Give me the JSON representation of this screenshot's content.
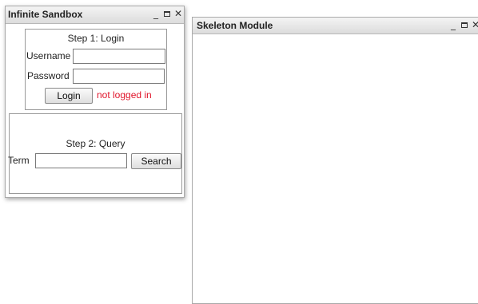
{
  "colors": {
    "status_error": "#e0142a",
    "titlebar": "#dcdcdc",
    "border": "#a9a9a9"
  },
  "sandbox_window": {
    "title": "Infinite Sandbox",
    "controls": {
      "minimize": "_",
      "maximize_icon": "maximize-icon",
      "close": "✕"
    },
    "login_panel": {
      "title": "Step 1: Login",
      "username_label": "Username",
      "username_value": "",
      "password_label": "Password",
      "password_value": "",
      "login_button": "Login",
      "status_text": "not logged in"
    },
    "query_panel": {
      "title": "Step 2: Query",
      "term_label": "Term",
      "term_value": "",
      "search_button": "Search"
    }
  },
  "skeleton_window": {
    "title": "Skeleton Module",
    "controls": {
      "minimize": "_",
      "maximize_icon": "maximize-icon",
      "close": "✕"
    }
  }
}
